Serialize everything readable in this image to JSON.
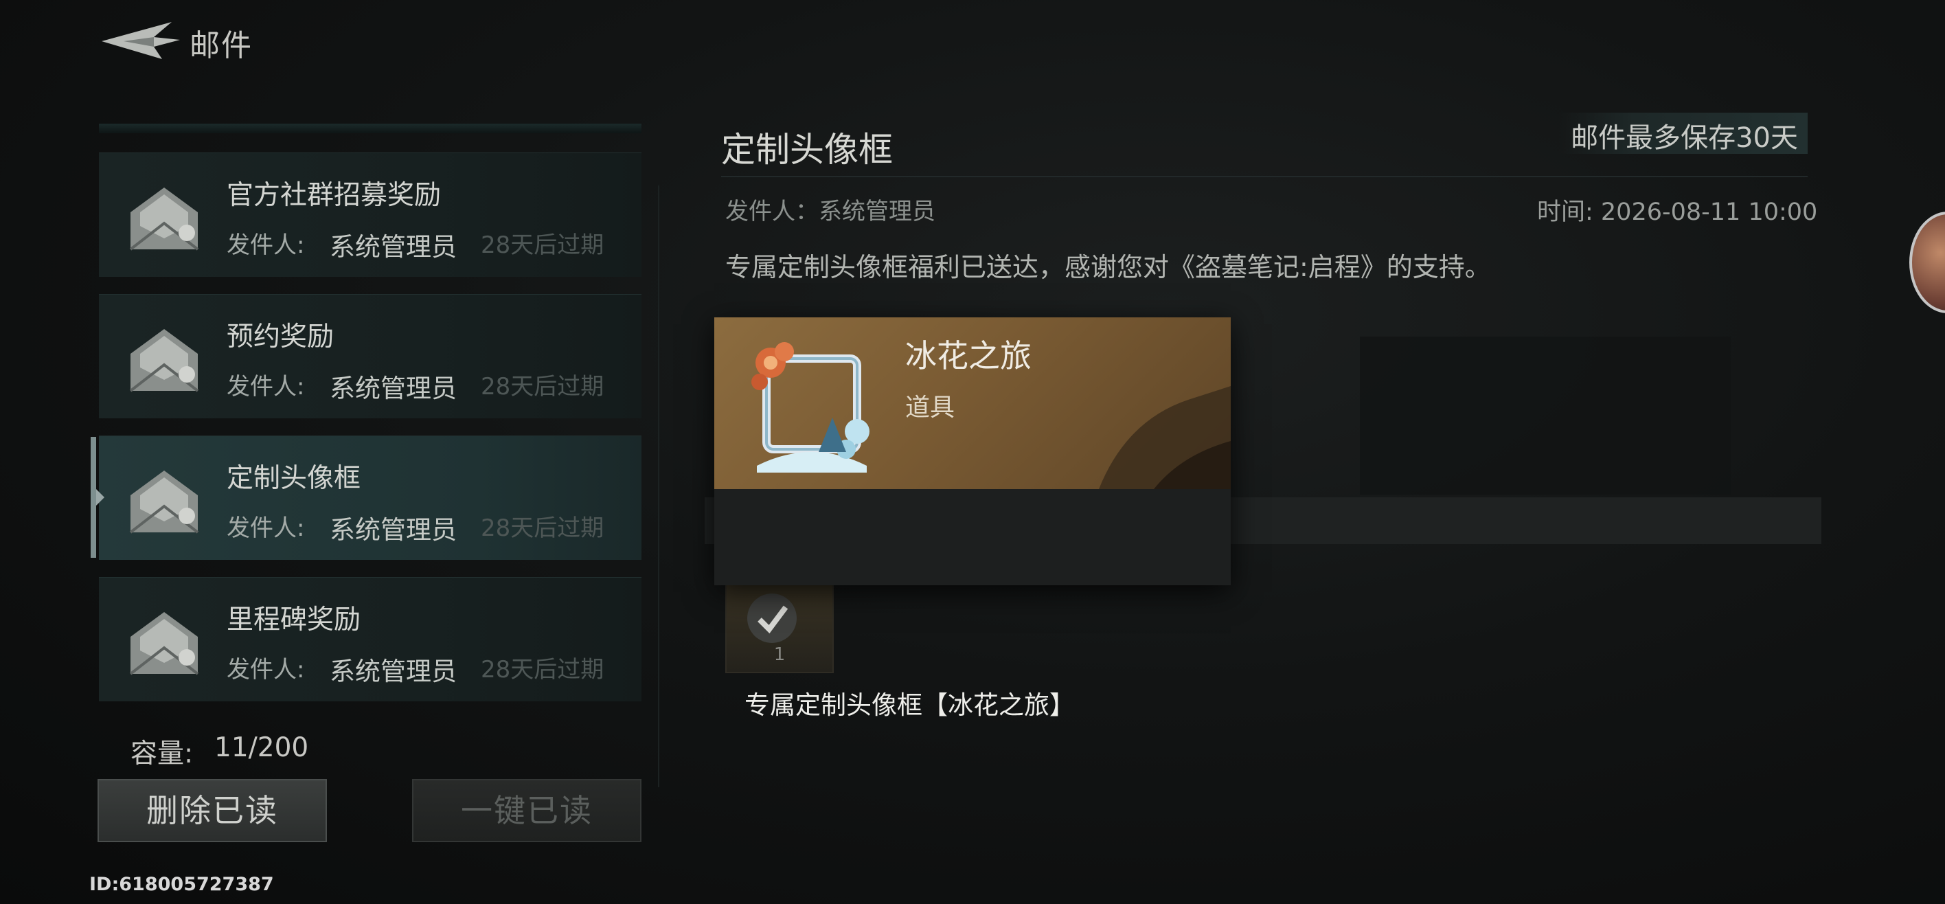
{
  "header": {
    "title": "邮件",
    "back_icon": "back-arrow-icon"
  },
  "mail_list": [
    {
      "title": "官方社群招募奖励",
      "sender_label": "发件人:",
      "sender": "系统管理员",
      "expire": "28天后过期",
      "selected": false,
      "icon": "mail-open-icon"
    },
    {
      "title": "预约奖励",
      "sender_label": "发件人:",
      "sender": "系统管理员",
      "expire": "28天后过期",
      "selected": false,
      "icon": "mail-open-icon"
    },
    {
      "title": "定制头像框",
      "sender_label": "发件人:",
      "sender": "系统管理员",
      "expire": "28天后过期",
      "selected": true,
      "icon": "mail-open-icon"
    },
    {
      "title": "里程碑奖励",
      "sender_label": "发件人:",
      "sender": "系统管理员",
      "expire": "28天后过期",
      "selected": false,
      "icon": "mail-open-icon"
    }
  ],
  "capacity": {
    "label": "容量:",
    "value": "11/200"
  },
  "buttons": {
    "delete_read": "删除已读",
    "mark_all_read": "一键已读"
  },
  "user_id": "ID:618005727387",
  "detail": {
    "title": "定制头像框",
    "retention_note": "邮件最多保存30天",
    "sender": "发件人：系统管理员",
    "time": "时间: 2026-08-11 10:00",
    "body": "专属定制头像框福利已送达，感谢您对《盗墓笔记:启程》的支持。"
  },
  "reward": {
    "count": "1",
    "claimed": true,
    "icon": "checkmark-icon"
  },
  "tooltip": {
    "name": "冰花之旅",
    "type": "道具",
    "description": "专属定制头像框【冰花之旅】",
    "icon": "avatar-frame-icon"
  },
  "colors": {
    "accent_gold": "#8c6c3f",
    "selected_row": "#24393a",
    "list_row": "#1a2424"
  }
}
